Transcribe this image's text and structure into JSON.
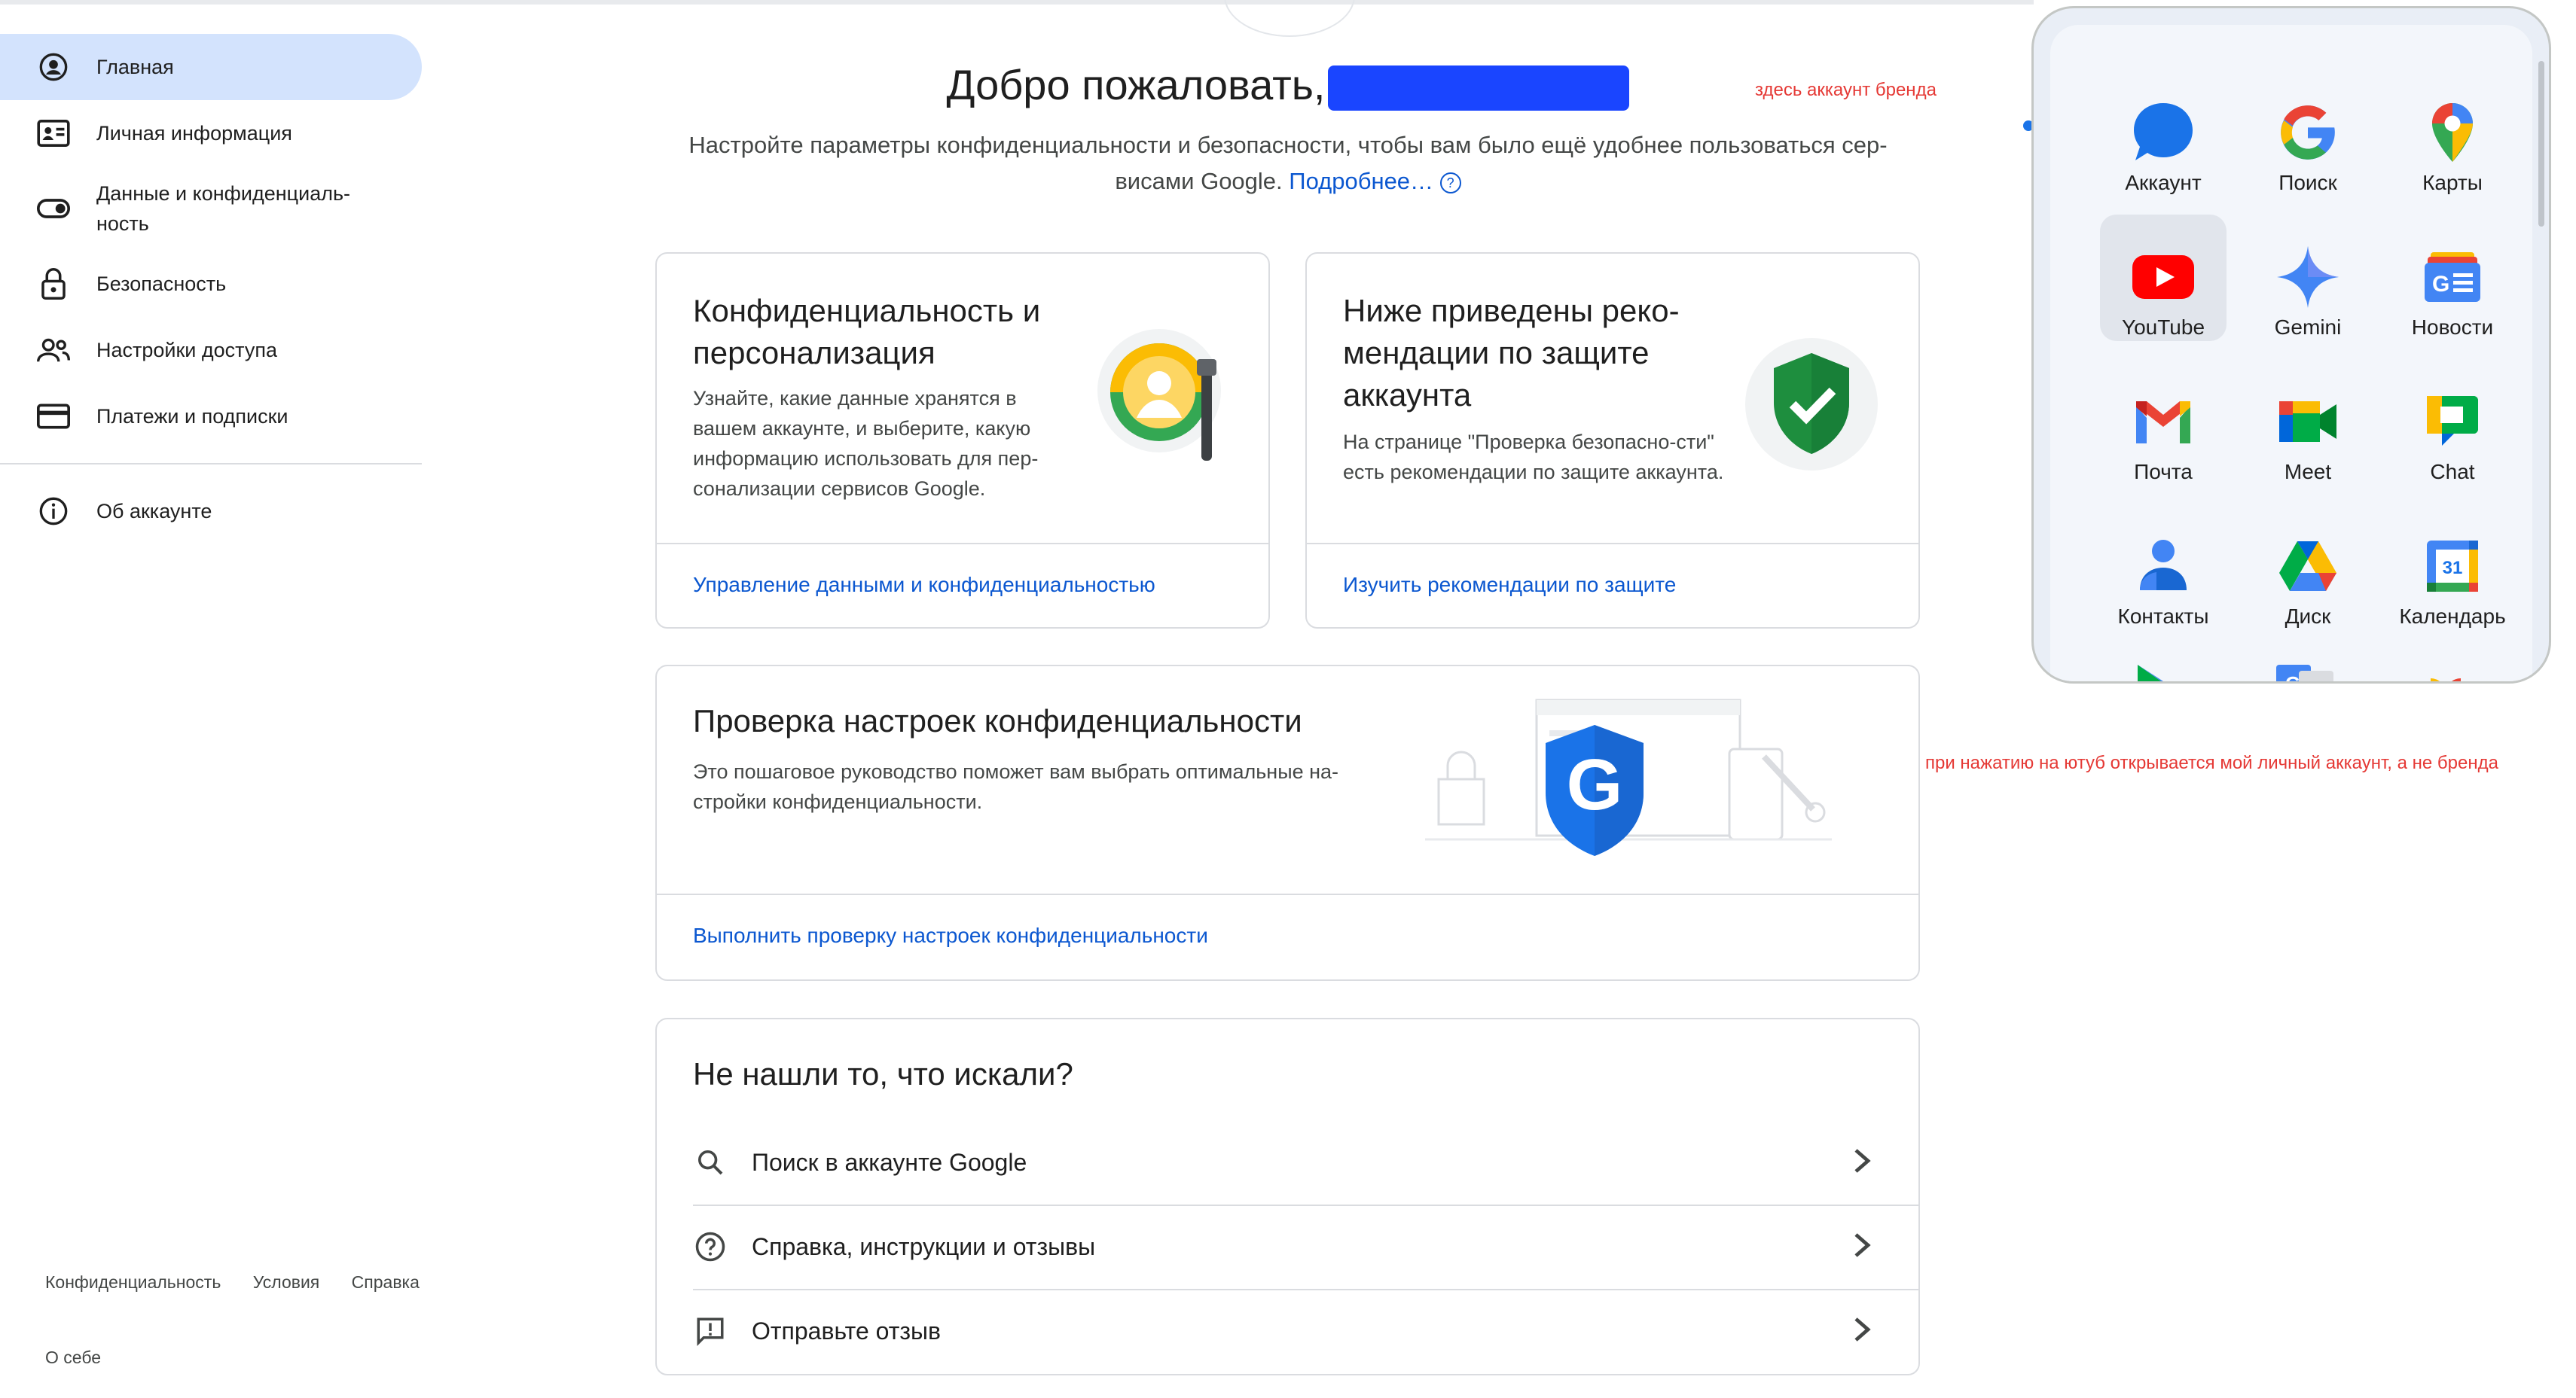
{
  "sidebar": {
    "items": [
      {
        "label": "Главная",
        "icon": "account-circle-icon"
      },
      {
        "label": "Личная информация",
        "icon": "id-card-icon"
      },
      {
        "label": "Данные и конфиденциаль-ность",
        "icon": "toggle-icon"
      },
      {
        "label": "Безопасность",
        "icon": "lock-icon"
      },
      {
        "label": "Настройки доступа",
        "icon": "people-icon"
      },
      {
        "label": "Платежи и подписки",
        "icon": "credit-card-icon"
      },
      {
        "label": "Об аккаунте",
        "icon": "info-icon"
      }
    ],
    "footer": {
      "privacy": "Конфиденциальность",
      "terms": "Условия",
      "help": "Справка",
      "about": "О себе"
    }
  },
  "welcome": {
    "title": "Добро пожаловать,",
    "description": "Настройте параметры конфиденциальности и безопасности, чтобы вам было ещё удобнее пользоваться сер-висами Google.",
    "more_link": "Подробнее…"
  },
  "cards": {
    "privacy": {
      "title": "Конфиденциальность и персонализация",
      "desc": "Узнайте, какие данные хранятся в вашем аккаунте, и выберите, какую информацию использовать для пер-сонализации сервисов Google.",
      "link": "Управление данными и конфиденциальностью"
    },
    "security": {
      "title": "Ниже приведены реко-мендации по защите аккаунта",
      "desc": "На странице \"Проверка безопасно-сти\" есть рекомендации по защите аккаунта.",
      "link": "Изучить рекомендации по защите"
    },
    "checkup": {
      "title": "Проверка настроек конфиденциальности",
      "desc": "Это пошаговое руководство поможет вам выбрать оптимальные на-стройки конфиденциальности.",
      "link": "Выполнить проверку настроек конфиденциальности"
    },
    "notfound": {
      "title": "Не нашли то, что искали?",
      "rows": [
        {
          "label": "Поиск в аккаунте Google",
          "icon": "search-icon"
        },
        {
          "label": "Справка, инструкции и отзывы",
          "icon": "help-icon"
        },
        {
          "label": "Отправьте отзыв",
          "icon": "feedback-icon"
        }
      ]
    }
  },
  "annotations": {
    "brand": "здесь аккаунт бренда",
    "youtube": "при нажатию на ютуб открывается мой личный аккаунт, а не бренда"
  },
  "apps": [
    {
      "label": "Аккаунт",
      "icon": "account-bubble-icon"
    },
    {
      "label": "Поиск",
      "icon": "google-g-icon"
    },
    {
      "label": "Карты",
      "icon": "maps-pin-icon"
    },
    {
      "label": "YouTube",
      "icon": "youtube-icon"
    },
    {
      "label": "Gemini",
      "icon": "gemini-sparkle-icon"
    },
    {
      "label": "Новости",
      "icon": "news-icon"
    },
    {
      "label": "Почта",
      "icon": "gmail-icon"
    },
    {
      "label": "Meet",
      "icon": "meet-icon"
    },
    {
      "label": "Chat",
      "icon": "chat-icon"
    },
    {
      "label": "Контакты",
      "icon": "contacts-icon"
    },
    {
      "label": "Диск",
      "icon": "drive-icon"
    },
    {
      "label": "Календарь",
      "icon": "calendar-icon"
    }
  ],
  "calendar_day": "31",
  "colors": {
    "accent": "#0b57d0",
    "active_nav": "#d3e3fd",
    "annotation": "#e53935",
    "redaction": "#1a45ff"
  }
}
